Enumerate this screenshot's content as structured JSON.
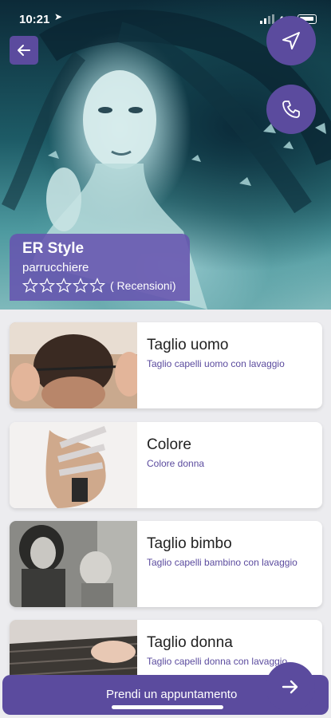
{
  "status_bar": {
    "time": "10:21",
    "network": "4G"
  },
  "header": {
    "business_name": "ER Style",
    "category": "parrucchiere",
    "rating_stars": 0,
    "rating_max": 5,
    "reviews_label": "( Recensioni)"
  },
  "icons": {
    "back": "arrow-left-icon",
    "navigate": "navigation-arrow-icon",
    "call": "phone-icon",
    "next": "arrow-right-icon",
    "star": "star-outline-icon"
  },
  "services": [
    {
      "title": "Taglio uomo",
      "description": "Taglio capelli uomo con lavaggio"
    },
    {
      "title": "Colore",
      "description": "Colore donna"
    },
    {
      "title": "Taglio bimbo",
      "description": "Taglio capelli bambino con lavaggio"
    },
    {
      "title": "Taglio donna",
      "description": "Taglio capelli donna con lavaggio"
    }
  ],
  "footer": {
    "book_label": "Prendi un appuntamento"
  },
  "colors": {
    "accent": "#5b4b9e",
    "card_overlay": "#6754af",
    "background": "#ececef"
  }
}
